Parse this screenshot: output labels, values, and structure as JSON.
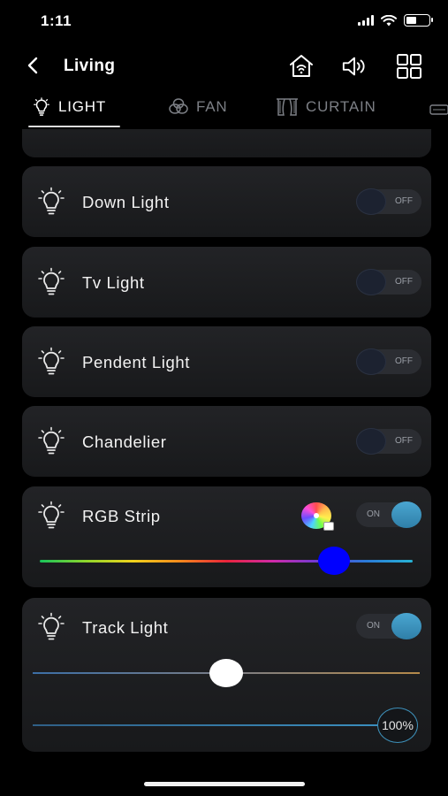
{
  "status": {
    "time": "1:11"
  },
  "nav": {
    "title": "Living"
  },
  "tabs": [
    {
      "label": "LIGHT",
      "icon": "bulb-icon",
      "active": true
    },
    {
      "label": "FAN",
      "icon": "fan-icon"
    },
    {
      "label": "CURTAIN",
      "icon": "curtain-icon"
    }
  ],
  "devices": [
    {
      "name": "Down Light",
      "state": "OFF"
    },
    {
      "name": "Tv Light",
      "state": "OFF"
    },
    {
      "name": "Pendent Light",
      "state": "OFF"
    },
    {
      "name": "Chandelier",
      "state": "OFF"
    },
    {
      "name": "RGB Strip",
      "state": "ON",
      "color_slider_position": 0.79
    },
    {
      "name": "Track Light",
      "state": "ON",
      "temperature_position": 0.5,
      "brightness": "100%"
    }
  ],
  "colors": {
    "background": "#000000",
    "card": "#1e1f22",
    "on_knob": "#3b93bf",
    "rgb_selected": "#0000ff",
    "text": "#f2f2f2",
    "inactive_tab": "#7c7f85"
  }
}
